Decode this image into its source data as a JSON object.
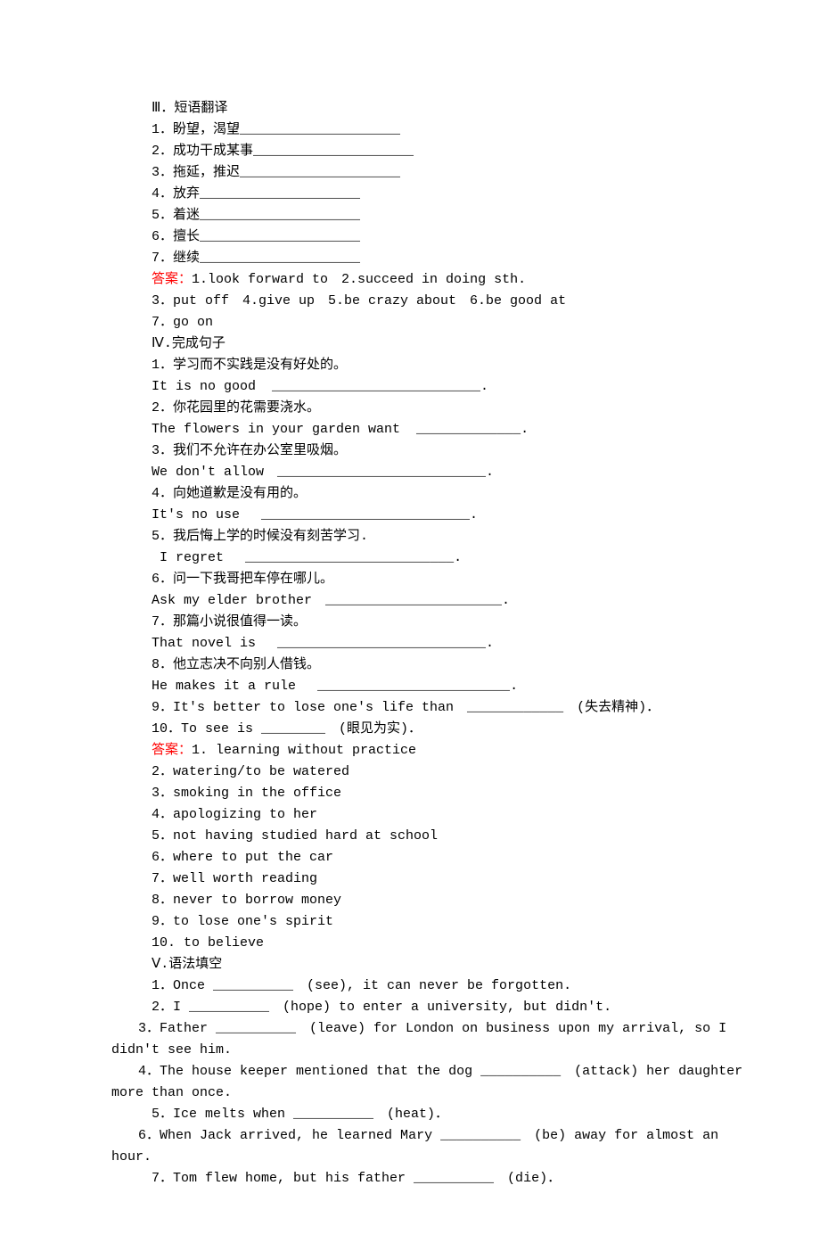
{
  "section3": {
    "title": "Ⅲ．短语翻译",
    "items": [
      "1．盼望，渴望____________________",
      "2．成功干成某事____________________",
      "3．拖延，推迟____________________",
      "4．放弃____________________",
      "5．着迷____________________",
      "6．擅长____________________",
      "7．继续____________________"
    ],
    "answer_label": "答案：",
    "answers": [
      "1.look forward to　2.succeed in doing sth.",
      "3．put off　4.give up　5.be crazy about　6.be good at",
      "7．go on"
    ]
  },
  "section4": {
    "title": "Ⅳ.完成句子",
    "pairs": [
      {
        "q": "1．学习而不实践是没有好处的。",
        "e": "It is no good  __________________________."
      },
      {
        "q": "2．你花园里的花需要浇水。",
        "e": "The flowers in your garden want  _____________."
      },
      {
        "q": "3．我们不允许在办公室里吸烟。",
        "e": "We don't allow　__________________________."
      },
      {
        "q": "4．向她道歉是没有用的。",
        "e": "It's no use　 __________________________."
      },
      {
        "q": "5．我后悔上学的时候没有刻苦学习.",
        "e": " I regret　 __________________________."
      },
      {
        "q": "6．问一下我哥把车停在哪儿。",
        "e": "Ask my elder brother　______________________."
      },
      {
        "q": "7．那篇小说很值得一读。",
        "e": "That novel is　 __________________________."
      },
      {
        "q": "8．他立志决不向别人借钱。",
        "e": "He makes it a rule　 ________________________."
      }
    ],
    "extra": [
      "9．It's better to lose one's life than　____________　(失去精神)．",
      "10．To see is ________　(眼见为实)．"
    ],
    "answer_label": "答案：",
    "answers": [
      "1. learning without practice",
      "2．watering/to be watered",
      "3．smoking in the office",
      "4．apologizing to her",
      "5．not having studied hard at school",
      "6．where to put the car",
      "7．well worth reading",
      "8．never to borrow money",
      "9．to lose one's spirit",
      "10. to believe"
    ]
  },
  "section5": {
    "title": "Ⅴ.语法填空",
    "items": [
      "1．Once __________　(see), it can never be forgotten.",
      "2．I __________　(hope) to enter a university, but didn't.",
      "3．Father __________　(leave) for London on business upon my arrival, so I didn't see him.",
      "4．The house keeper mentioned that the dog __________　(attack) her daughter more than once.",
      "5．Ice melts when __________　(heat)．",
      "6．When Jack arrived, he learned Mary __________　(be) away for almost an hour.",
      "7．Tom flew home, but his father __________　(die)．"
    ]
  }
}
